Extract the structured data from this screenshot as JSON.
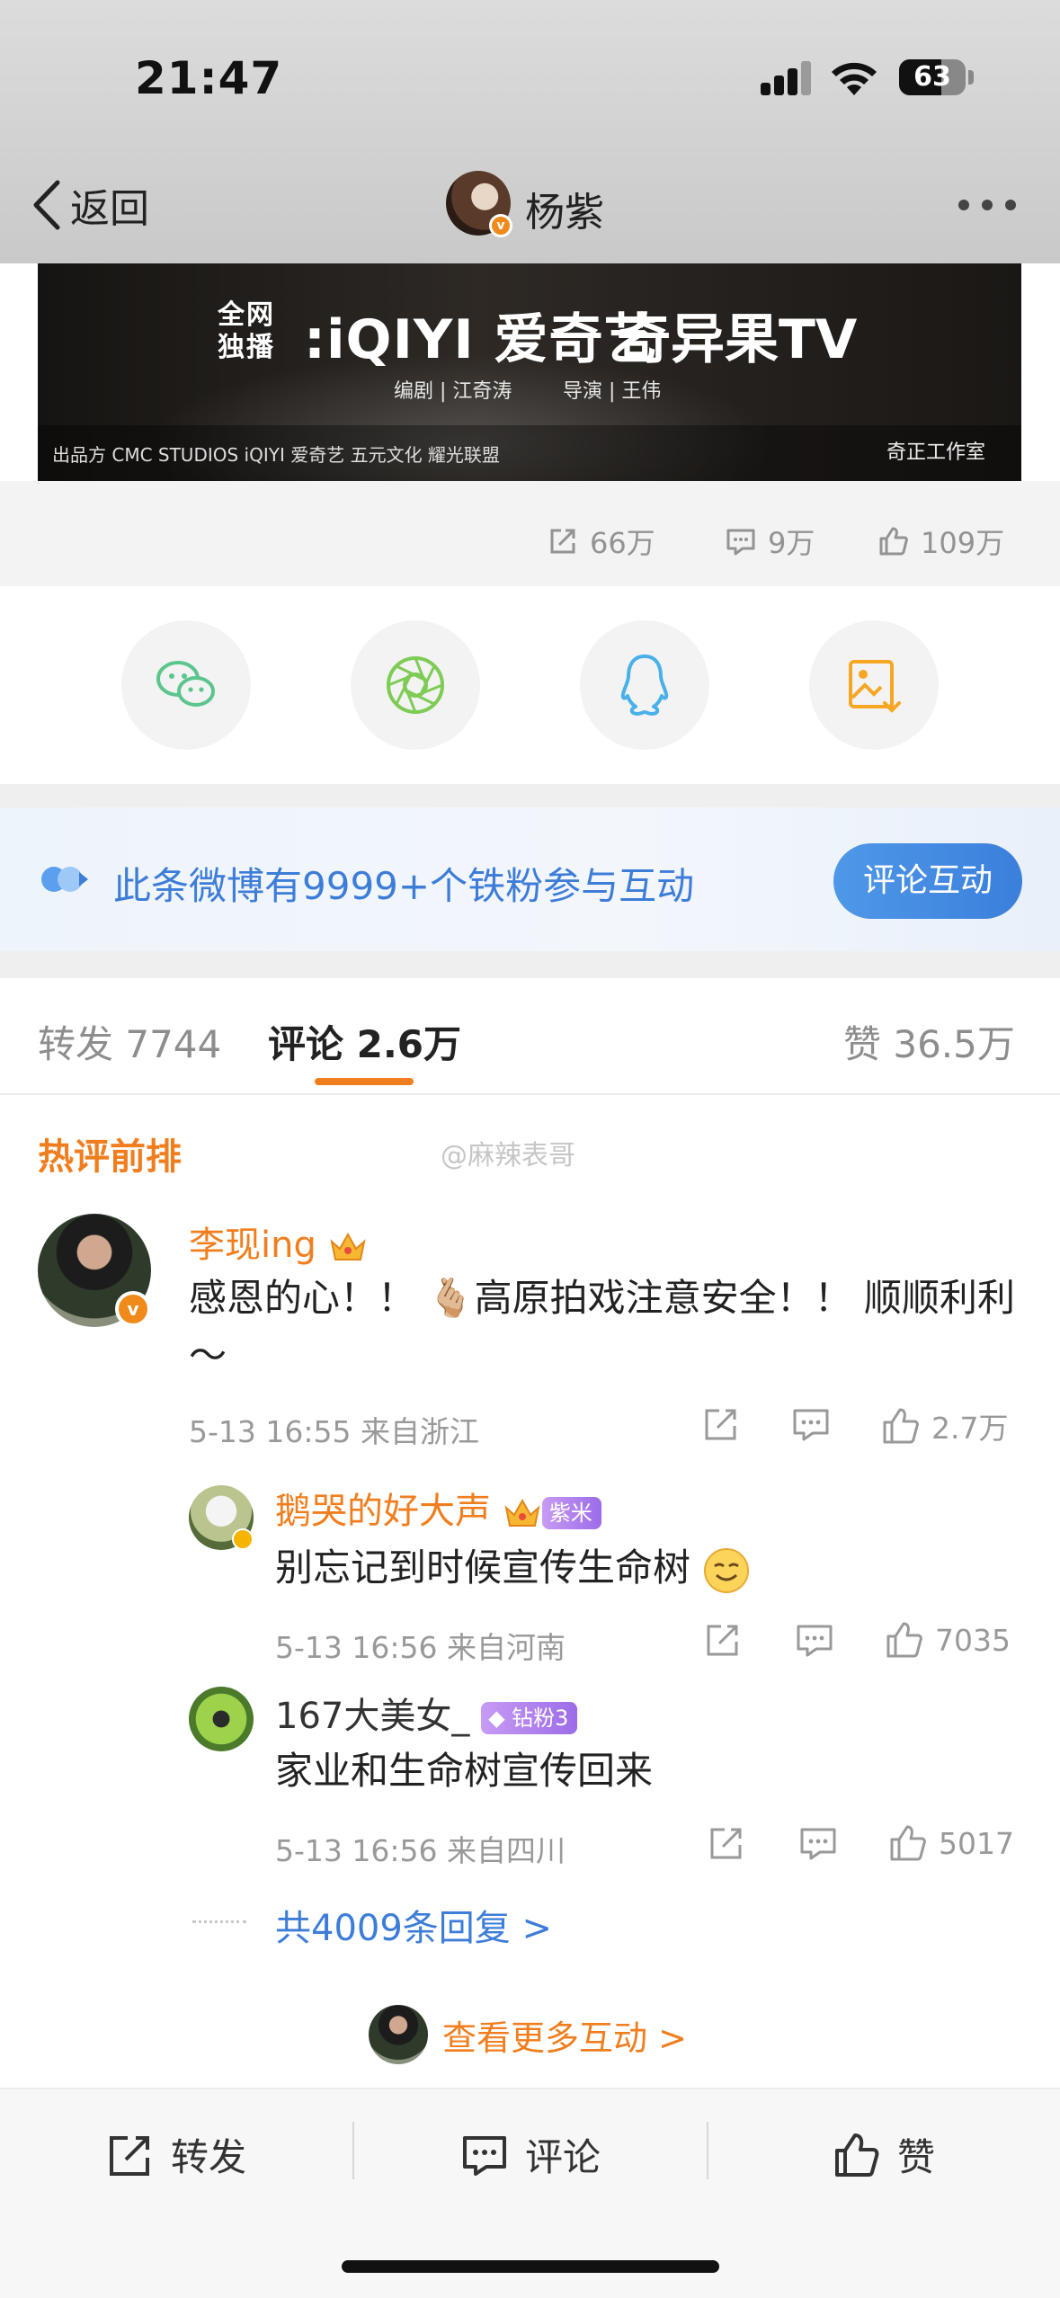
{
  "status_bar": {
    "time": "21:47",
    "battery": "63",
    "battery_level": 0.63
  },
  "nav": {
    "back_label": "返回",
    "title": "杨紫",
    "verified_badge": "v"
  },
  "banner": {
    "label_quanwang": "全网独播",
    "brand1": ":iQIYI 爱奇艺",
    "brand2": "奇异果TV",
    "credit_writer": "编剧 | 江奇涛",
    "credit_director": "导演 | 王伟",
    "logos": "出品方   CMC STUDIOS   iQIYI 爱奇艺   五元文化   耀光联盟",
    "studio": "奇正工作室"
  },
  "stats": {
    "reposts": "66万",
    "comments": "9万",
    "likes": "109万"
  },
  "share": {
    "icons": [
      "wechat-icon",
      "moments-icon",
      "qq-icon",
      "save-image-icon"
    ]
  },
  "promo": {
    "text": "此条微博有9999+个铁粉参与互动",
    "button": "评论互动"
  },
  "tabs": {
    "repost_label": "转发 7744",
    "comment_label": "评论 2.6万",
    "like_label": "赞 36.5万"
  },
  "hot": {
    "label": "热评前排",
    "watermark": "@麻辣表哥"
  },
  "comments": [
    {
      "user": "李现ing",
      "text": "感恩的心！！ 🫰🏼高原拍戏注意安全！！ 顺顺利利～",
      "time_loc": "5-13 16:55  来自浙江",
      "likes": "2.7万",
      "replies": [
        {
          "user": "鹅哭的好大声",
          "badge": "紫米",
          "text": "别忘记到时候宣传生命树",
          "time_loc": "5-13 16:56  来自河南",
          "likes": "7035"
        },
        {
          "user": "167大美女_",
          "badge": "钻粉3",
          "text": "家业和生命树宣传回来",
          "time_loc": "5-13 16:56  来自四川",
          "likes": "5017"
        }
      ],
      "more_replies": "共4009条回复 >"
    }
  ],
  "view_more": "查看更多互动 >",
  "toolbar": {
    "repost": "转发",
    "comment": "评论",
    "like": "赞"
  },
  "colors": {
    "accent_orange": "#f07e1e",
    "link_blue": "#3d7dd8"
  }
}
